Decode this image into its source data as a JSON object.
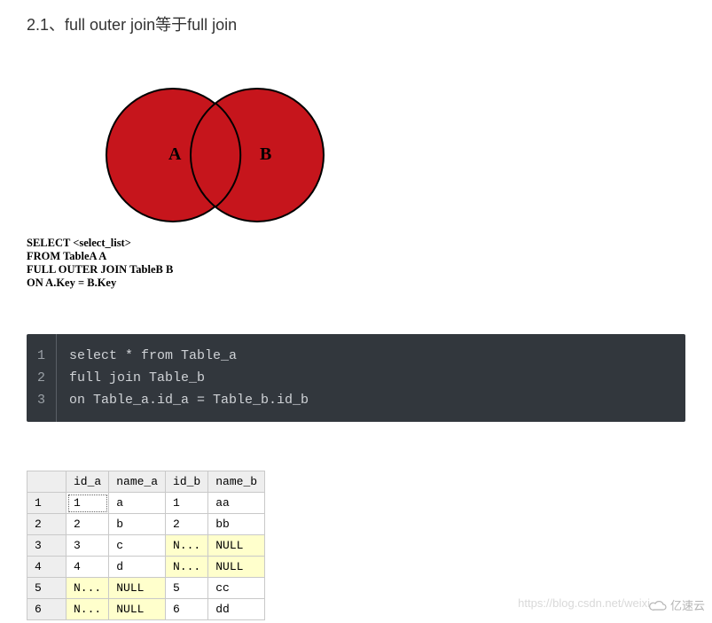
{
  "heading": "2.1、full outer join等于full join",
  "venn": {
    "labelA": "A",
    "labelB": "B",
    "sql_lines": [
      "SELECT <select_list>",
      "FROM TableA A",
      "FULL OUTER JOIN TableB B",
      "ON A.Key = B.Key"
    ],
    "fill_color": "#c6151c"
  },
  "code": {
    "gutter": [
      "1",
      "2",
      "3"
    ],
    "lines": [
      "select * from Table_a",
      "full join Table_b",
      "on Table_a.id_a = Table_b.id_b"
    ]
  },
  "table": {
    "columns": [
      "id_a",
      "name_a",
      "id_b",
      "name_b"
    ],
    "rows": [
      {
        "n": "1",
        "cells": [
          {
            "v": "1",
            "dotted": true
          },
          {
            "v": "a"
          },
          {
            "v": "1"
          },
          {
            "v": "aa"
          }
        ]
      },
      {
        "n": "2",
        "cells": [
          {
            "v": "2"
          },
          {
            "v": "b"
          },
          {
            "v": "2"
          },
          {
            "v": "bb"
          }
        ]
      },
      {
        "n": "3",
        "cells": [
          {
            "v": "3"
          },
          {
            "v": "c"
          },
          {
            "v": "N...",
            "null": true
          },
          {
            "v": "NULL",
            "null": true
          }
        ]
      },
      {
        "n": "4",
        "cells": [
          {
            "v": "4"
          },
          {
            "v": "d"
          },
          {
            "v": "N...",
            "null": true
          },
          {
            "v": "NULL",
            "null": true
          }
        ]
      },
      {
        "n": "5",
        "cells": [
          {
            "v": "N...",
            "null": true
          },
          {
            "v": "NULL",
            "null": true
          },
          {
            "v": "5"
          },
          {
            "v": "cc"
          }
        ]
      },
      {
        "n": "6",
        "cells": [
          {
            "v": "N...",
            "null": true
          },
          {
            "v": "NULL",
            "null": true
          },
          {
            "v": "6"
          },
          {
            "v": "dd"
          }
        ]
      }
    ]
  },
  "watermark": "https://blog.csdn.net/weixi",
  "brand": "亿速云"
}
